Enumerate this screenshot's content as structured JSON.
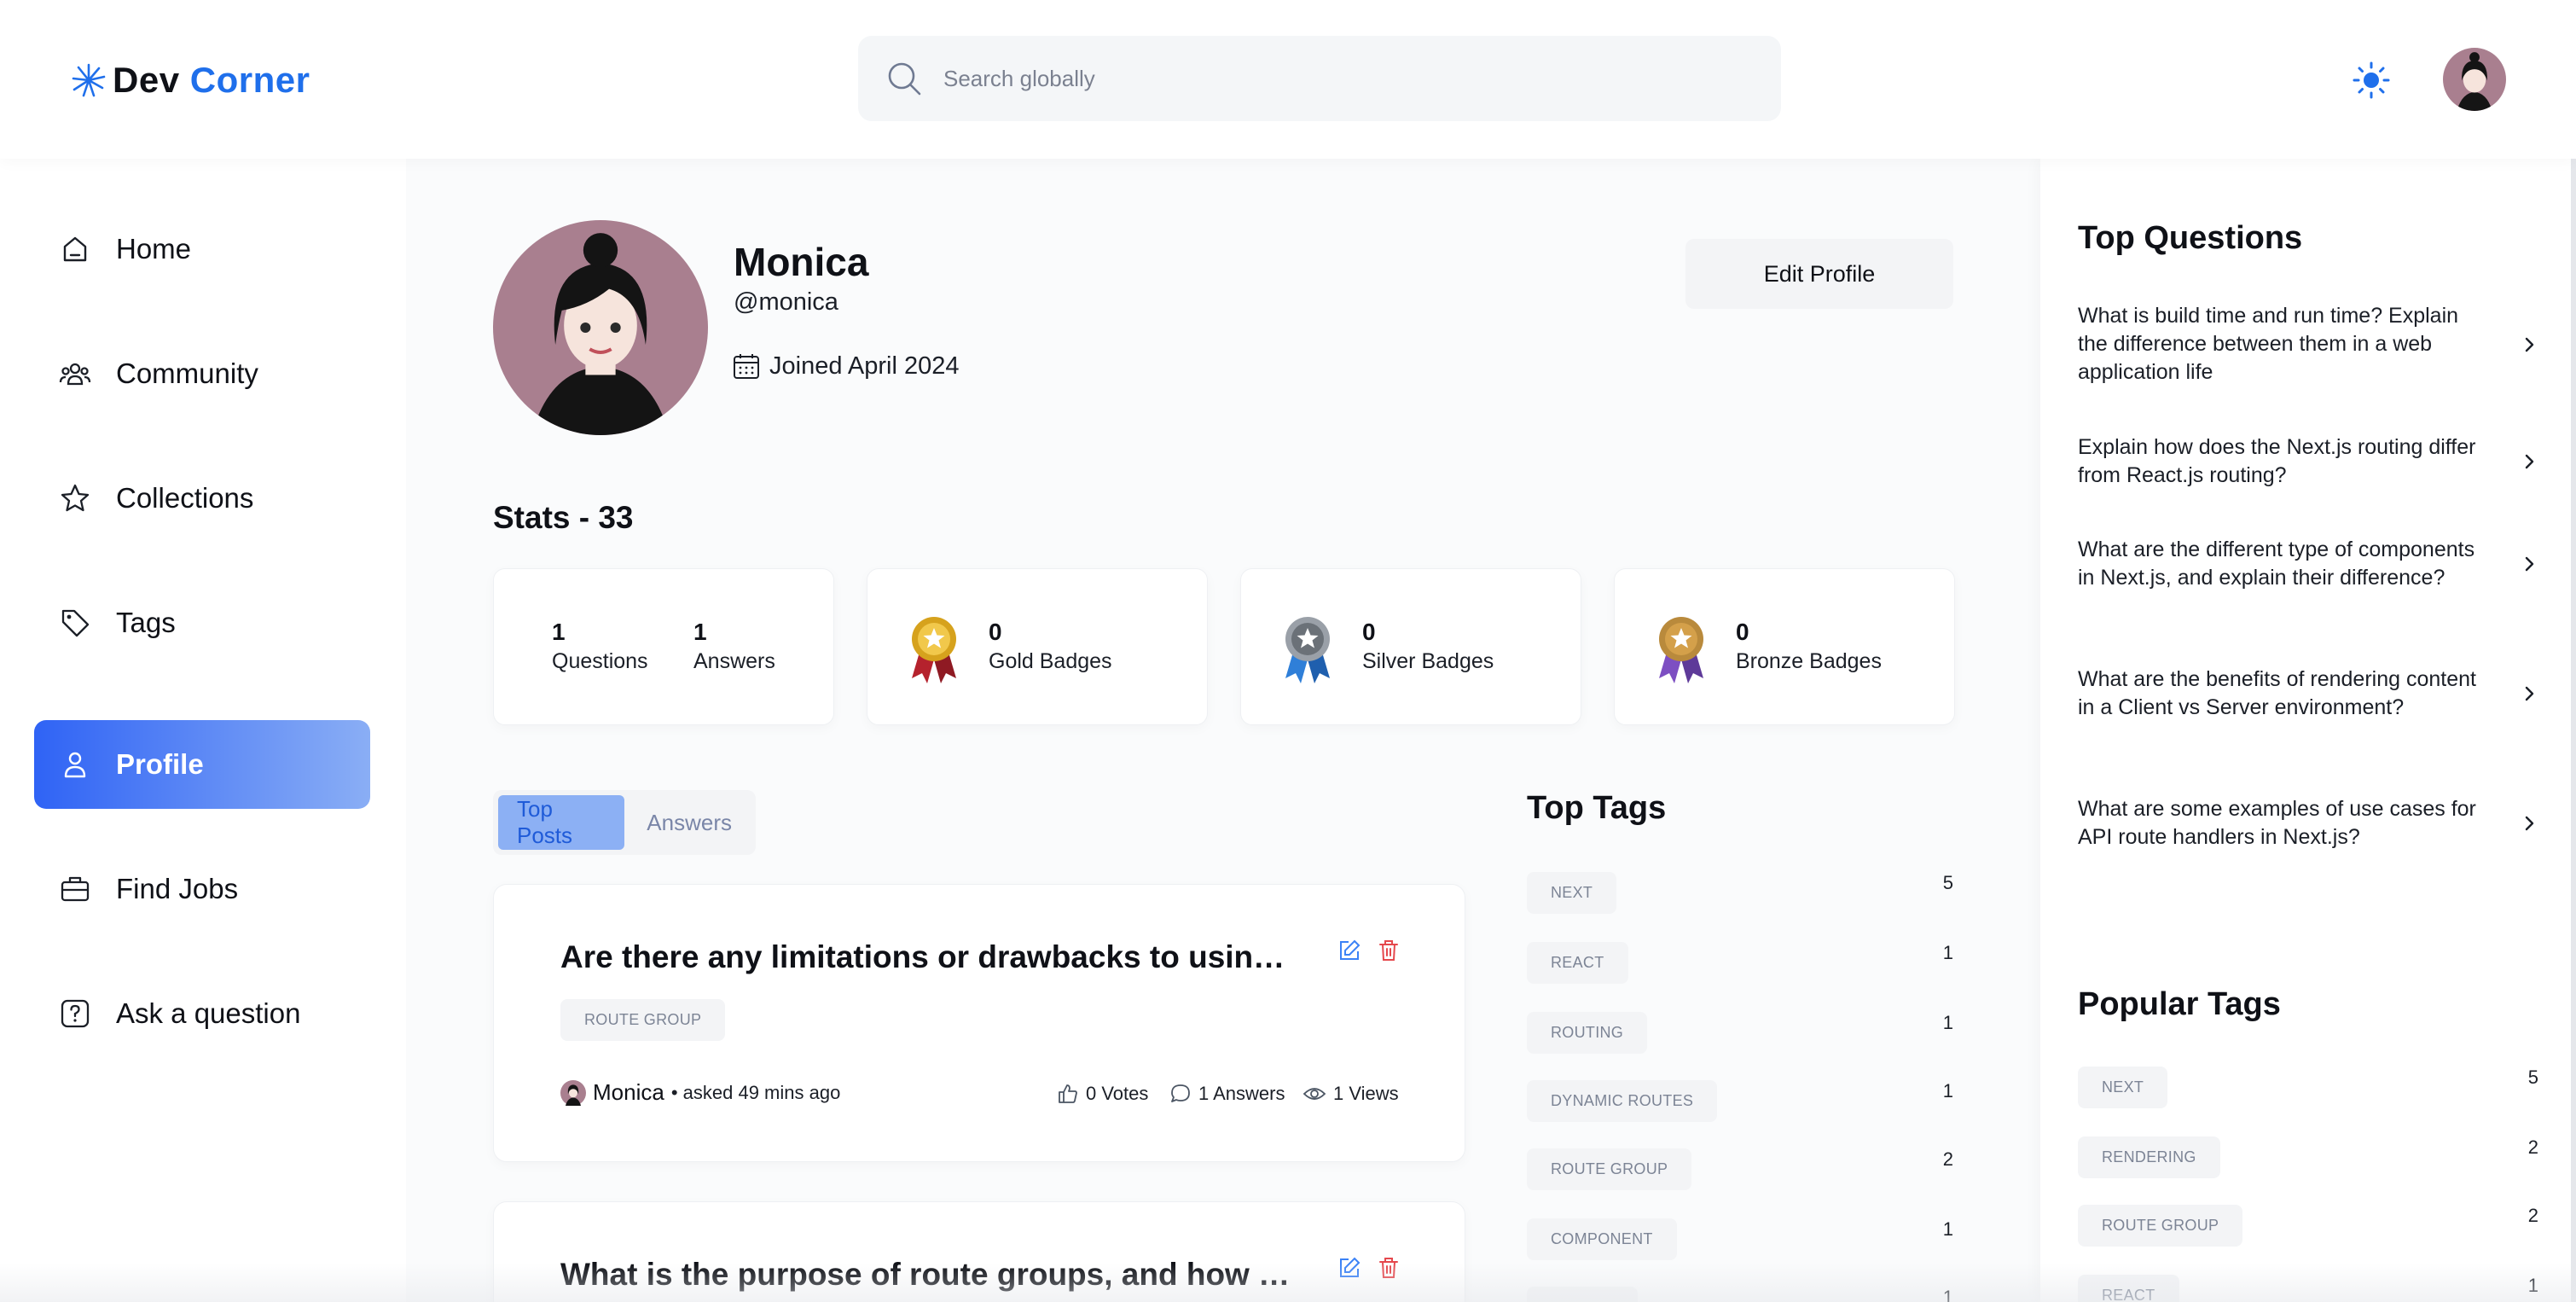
{
  "header": {
    "logo_prefix": "Dev",
    "logo_suffix": "Corner",
    "search_placeholder": "Search globally"
  },
  "sidebar": {
    "items": [
      {
        "label": "Home",
        "icon": "home-icon"
      },
      {
        "label": "Community",
        "icon": "users-icon"
      },
      {
        "label": "Collections",
        "icon": "star-icon"
      },
      {
        "label": "Tags",
        "icon": "tag-icon"
      },
      {
        "label": "Profile",
        "icon": "user-icon",
        "active": true
      },
      {
        "label": "Find Jobs",
        "icon": "briefcase-icon"
      },
      {
        "label": "Ask a question",
        "icon": "question-icon"
      }
    ]
  },
  "profile": {
    "name": "Monica",
    "username": "@monica",
    "joined": "Joined April 2024",
    "edit_label": "Edit Profile"
  },
  "stats": {
    "title": "Stats - 33",
    "questions": "1",
    "questions_label": "Questions",
    "answers": "1",
    "answers_label": "Answers",
    "gold": "0",
    "gold_label": "Gold Badges",
    "silver": "0",
    "silver_label": "Silver Badges",
    "bronze": "0",
    "bronze_label": "Bronze Badges"
  },
  "tabs": {
    "top_posts": "Top Posts",
    "answers": "Answers"
  },
  "posts": [
    {
      "title": "Are there any limitations or drawbacks to using file-based routing in Next.js?",
      "tag": "ROUTE GROUP",
      "author": "Monica",
      "ago": "• asked 49 mins ago",
      "votes": "0 Votes",
      "answers": "1 Answers",
      "views": "1 Views"
    },
    {
      "title": "What is the purpose of route groups, and how can they be used?"
    }
  ],
  "top_tags": {
    "title": "Top Tags",
    "items": [
      {
        "name": "NEXT",
        "count": "5"
      },
      {
        "name": "REACT",
        "count": "1"
      },
      {
        "name": "ROUTING",
        "count": "1"
      },
      {
        "name": "DYNAMIC ROUTES",
        "count": "1"
      },
      {
        "name": "ROUTE GROUP",
        "count": "2"
      },
      {
        "name": "COMPONENT",
        "count": "1"
      },
      {
        "name": "",
        "count": "1"
      }
    ]
  },
  "right": {
    "top_questions_title": "Top Questions",
    "questions": [
      "What is build time and run time? Explain the difference between them in a web application life",
      "Explain how does the Next.js routing differ from React.js routing?",
      "What are the different type of components in Next.js, and explain their difference?",
      "What are the benefits of rendering content in a Client vs Server environment?",
      "What are some examples of use cases for API route handlers in Next.js?"
    ],
    "popular_tags_title": "Popular Tags",
    "popular_tags": [
      {
        "name": "NEXT",
        "count": "5"
      },
      {
        "name": "RENDERING",
        "count": "2"
      },
      {
        "name": "ROUTE GROUP",
        "count": "2"
      },
      {
        "name": "REACT",
        "count": "1"
      }
    ]
  },
  "colors": {
    "accent": "#1f6feb",
    "active_gradient_start": "#2f63f5",
    "active_gradient_end": "#8aaef5",
    "delete": "#e5484d"
  }
}
